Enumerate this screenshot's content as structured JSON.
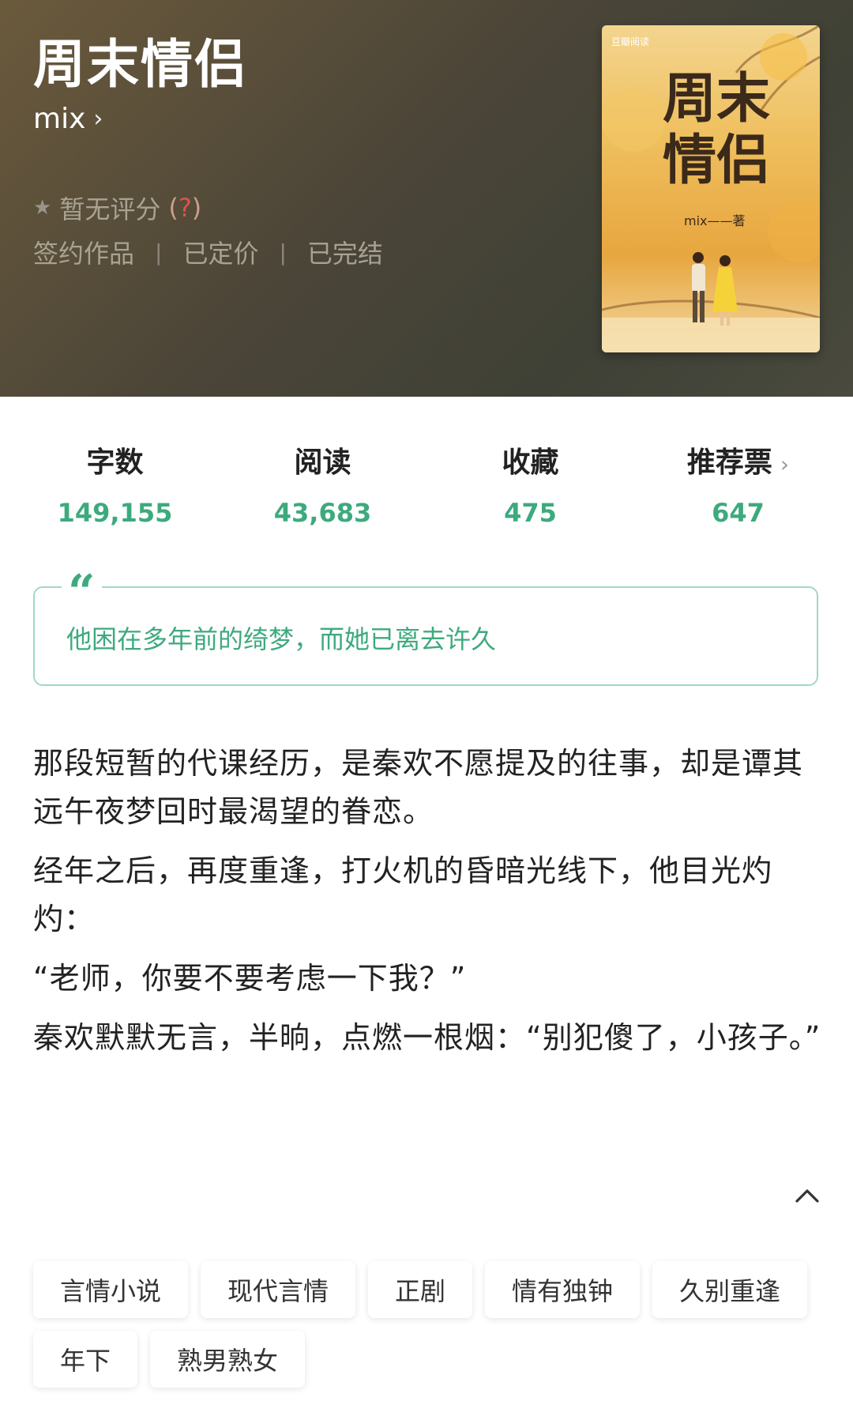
{
  "book": {
    "title": "周末情侣",
    "author": "mix",
    "rating_text": "暂无评分",
    "rating_help": "?",
    "badges": [
      "签约作品",
      "已定价",
      "已完结"
    ]
  },
  "cover": {
    "brand": "豆瓣阅读",
    "title": "周末情侣",
    "author_line": "mix——著"
  },
  "stats": [
    {
      "label": "字数",
      "value": "149,155"
    },
    {
      "label": "阅读",
      "value": "43,683"
    },
    {
      "label": "收藏",
      "value": "475"
    },
    {
      "label": "推荐票",
      "value": "647"
    }
  ],
  "quote": "他困在多年前的绮梦，而她已离去许久",
  "description": [
    "那段短暂的代课经历，是秦欢不愿提及的往事，却是谭其远午夜梦回时最渴望的眷恋。",
    "经年之后，再度重逢，打火机的昏暗光线下，他目光灼灼：",
    "“老师，你要不要考虑一下我？”",
    "秦欢默默无言，半晌，点燃一根烟：“别犯傻了，小孩子。”"
  ],
  "tags": [
    "言情小说",
    "现代言情",
    "正剧",
    "情有独钟",
    "久别重逢",
    "年下",
    "熟男熟女"
  ],
  "colors": {
    "accent": "#3daa7e"
  }
}
